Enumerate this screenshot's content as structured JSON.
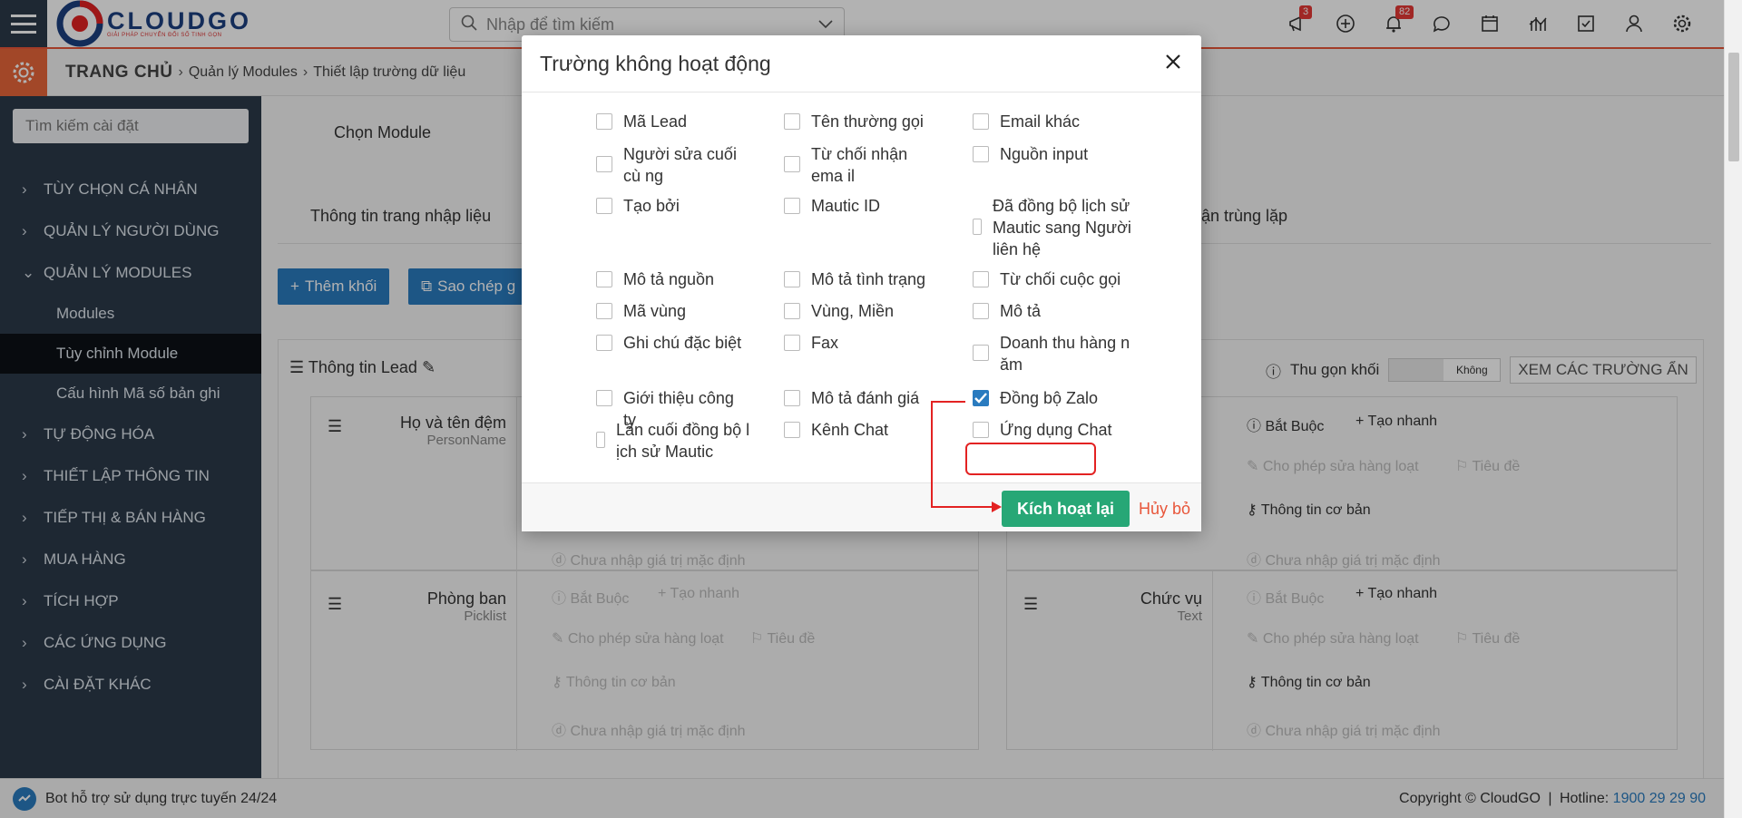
{
  "header": {
    "logo_title": "CLOUDGO",
    "logo_sub": "GIẢI PHÁP CHUYỂN ĐỔI SỐ TINH GỌN",
    "search_placeholder": "Nhập để tìm kiếm",
    "badges": {
      "announcements": "3",
      "notifications": "82"
    }
  },
  "breadcrumb": {
    "home": "TRANG CHỦ",
    "items": [
      "Quản lý Modules",
      "Thiết lập trường dữ liệu"
    ]
  },
  "sidebar": {
    "search_placeholder": "Tìm kiếm cài đặt",
    "items": [
      {
        "label": "TÙY CHỌN CÁ NHÂN"
      },
      {
        "label": "QUẢN LÝ NGƯỜI DÙNG"
      },
      {
        "label": "QUẢN LÝ MODULES"
      },
      {
        "label": "Modules"
      },
      {
        "label": "Tùy chỉnh Module"
      },
      {
        "label": "Cấu hình Mã số bản ghi"
      },
      {
        "label": "TỰ ĐỘNG HÓA"
      },
      {
        "label": "THIẾT LẬP THÔNG TIN"
      },
      {
        "label": "TIẾP THỊ & BÁN HÀNG"
      },
      {
        "label": "MUA HÀNG"
      },
      {
        "label": "TÍCH HỢP"
      },
      {
        "label": "CÁC ỨNG DỤNG"
      },
      {
        "label": "CÀI ĐẶT KHÁC"
      }
    ]
  },
  "main": {
    "choose_module": "Chọn Module",
    "tab_input": "Thông tin trang nhập liệu",
    "tab_dup_fragment": "ận trùng lặp",
    "add_block": "Thêm khối",
    "copy_fragment": "Sao chép g",
    "block_title": "Thông tin Lead",
    "collapse_label": "Thu gọn khối",
    "toggle_label": "Không",
    "view_hidden": "XEM CÁC TRƯỜNG ẨN",
    "fields": [
      {
        "name": "Họ và tên đệm",
        "type": "PersonName"
      },
      {
        "name": "Phòng ban",
        "type": "Picklist"
      },
      {
        "name": "Chức vụ",
        "type": "Text"
      }
    ],
    "options": {
      "required": "Bắt Buộc",
      "quick_create": "Tạo nhanh",
      "mass_edit": "Cho phép sửa hàng loạt",
      "title": "Tiêu đề",
      "basic_info": "Thông tin cơ bản",
      "no_default": "Chưa nhập giá trị mặc định"
    }
  },
  "modal": {
    "title": "Trường không hoạt động",
    "fields": [
      {
        "label": "Mã Lead",
        "checked": false
      },
      {
        "label": "Tên thường gọi",
        "checked": false
      },
      {
        "label": "Email khác",
        "checked": false
      },
      {
        "label": "Người sửa cuối cù ng",
        "checked": false
      },
      {
        "label": "Từ chối nhận ema il",
        "checked": false
      },
      {
        "label": "Nguồn input",
        "checked": false
      },
      {
        "label": "Tạo bởi",
        "checked": false
      },
      {
        "label": "Mautic ID",
        "checked": false
      },
      {
        "label": "Đã đồng bộ lịch sử Mautic sang Người liên hệ",
        "checked": false
      },
      {
        "label": "Mô tả nguồn",
        "checked": false
      },
      {
        "label": "Mô tả tình trạng",
        "checked": false
      },
      {
        "label": "Từ chối cuộc gọi",
        "checked": false
      },
      {
        "label": "Mã vùng",
        "checked": false
      },
      {
        "label": "Vùng, Miền",
        "checked": false
      },
      {
        "label": "Mô tả",
        "checked": false
      },
      {
        "label": "Ghi chú đặc biệt",
        "checked": false
      },
      {
        "label": "Fax",
        "checked": false
      },
      {
        "label": "Doanh thu hàng n ăm",
        "checked": false
      },
      {
        "label": "Giới thiệu công ty",
        "checked": false
      },
      {
        "label": "Mô tả đánh giá",
        "checked": false
      },
      {
        "label": "Đồng bộ Zalo",
        "checked": true
      },
      {
        "label": "Lần cuối đồng bộ l ịch sử Mautic",
        "checked": false
      },
      {
        "label": "Kênh Chat",
        "checked": false
      },
      {
        "label": "Ứng dụng Chat",
        "checked": false
      }
    ],
    "reactivate_label": "Kích hoạt lại",
    "cancel_label": "Hủy bỏ"
  },
  "footer": {
    "chat_bot": "Bot hỗ trợ sử dụng trực tuyến 24/24",
    "copyright": "Copyright © CloudGO",
    "hotline_label": "Hotline:",
    "hotline": "1900 29 29 90"
  },
  "colors": {
    "accent": "#e8563a",
    "sidebar": "#2b3a4a",
    "primary": "#2a7bbf",
    "success": "#27a776",
    "highlight": "#e32222"
  }
}
